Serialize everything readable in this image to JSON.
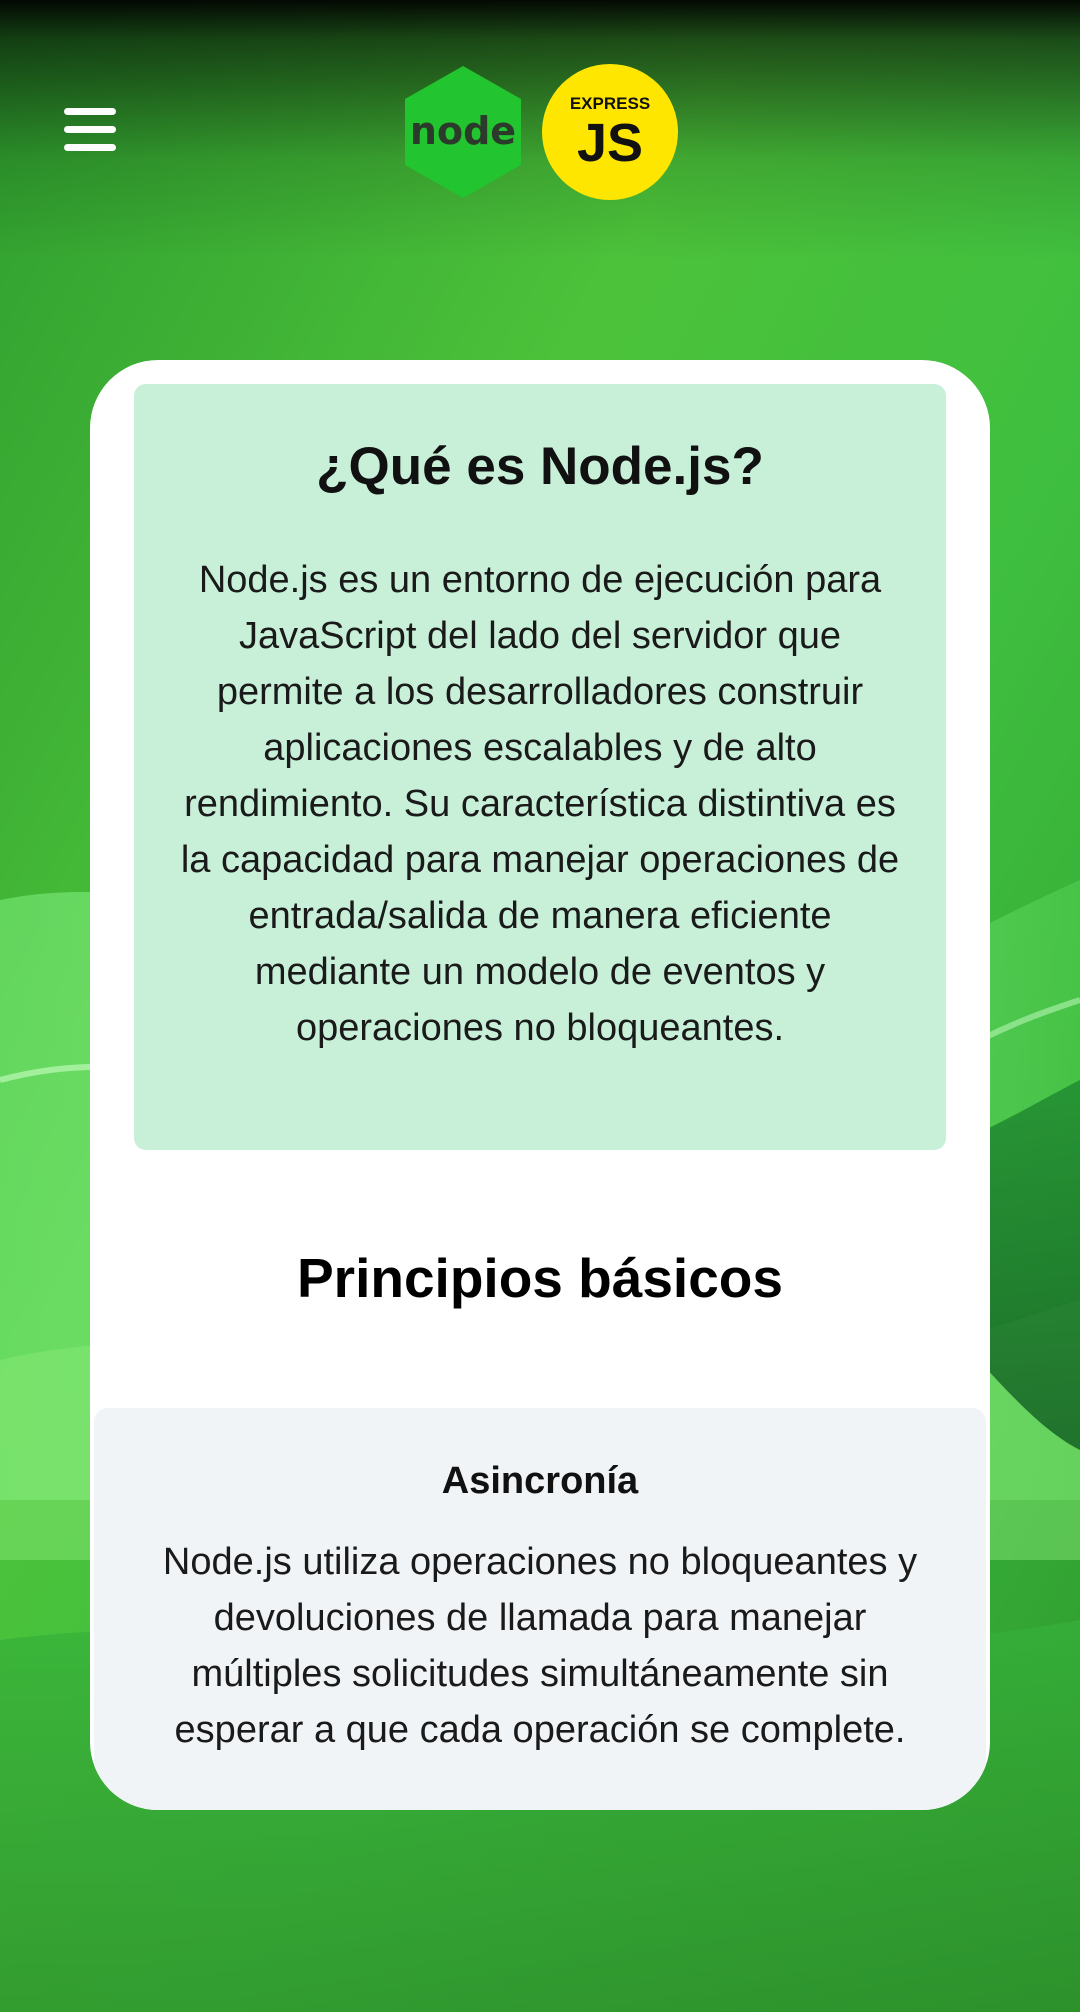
{
  "header": {
    "menu_icon": "hamburger-menu-icon",
    "logos": {
      "node": {
        "text": "node",
        "color": "#22c42f"
      },
      "express": {
        "small_text": "EXPRESS",
        "big_text": "JS",
        "color": "#ffe600"
      }
    }
  },
  "intro": {
    "title": "¿Qué es Node.js?",
    "text": "Node.js es un entorno de ejecución para JavaScript del lado del servidor que permite a los desarrolladores construir aplicaciones escalables y de alto rendimiento. Su característica distintiva es la capacidad para manejar operaciones de entrada/salida de manera eficiente mediante un modelo de eventos y operaciones no bloqueantes.",
    "background": "#c8f0d8"
  },
  "principles": {
    "title": "Principios básicos",
    "items": [
      {
        "title": "Asincronía",
        "text": "Node.js utiliza operaciones no bloqueantes y devoluciones de llamada para manejar múltiples solicitudes simultáneamente sin esperar a que cada operación se complete."
      }
    ]
  },
  "colors": {
    "page_green": "#3fbf3f",
    "card": "#ffffff",
    "principle_box": "#f0f4f6"
  }
}
